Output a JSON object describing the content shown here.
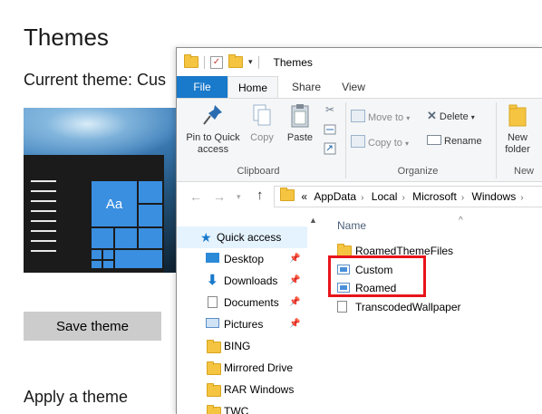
{
  "settings": {
    "title": "Themes",
    "current_theme": "Current theme: Cus",
    "preview_tile_text": "Aa",
    "save_button": "Save theme",
    "apply_title": "Apply a theme"
  },
  "explorer": {
    "window_title": "Themes",
    "tabs": {
      "file": "File",
      "home": "Home",
      "share": "Share",
      "view": "View"
    },
    "ribbon": {
      "pin_quick_access": "Pin to Quick access",
      "copy": "Copy",
      "paste": "Paste",
      "clipboard_group": "Clipboard",
      "move_to": "Move to",
      "copy_to": "Copy to",
      "delete": "Delete",
      "rename": "Rename",
      "organize_group": "Organize",
      "new_folder": "New folder",
      "new_group": "New"
    },
    "address": {
      "overflow": "«",
      "crumbs": [
        "AppData",
        "Local",
        "Microsoft",
        "Windows"
      ]
    },
    "nav": {
      "quick_access": "Quick access",
      "items": [
        "Desktop",
        "Downloads",
        "Documents",
        "Pictures",
        "BING",
        "Mirrored Drive",
        "RAR Windows",
        "TWC"
      ]
    },
    "content": {
      "column_name": "Name",
      "files": [
        "RoamedThemeFiles",
        "Custom",
        "Roamed",
        "TranscodedWallpaper"
      ]
    }
  },
  "colors": {
    "accent": "#1979ca",
    "tile_blue": "#3a8fe0",
    "highlight_red": "#e8141b",
    "folder_yellow": "#f5c542"
  }
}
